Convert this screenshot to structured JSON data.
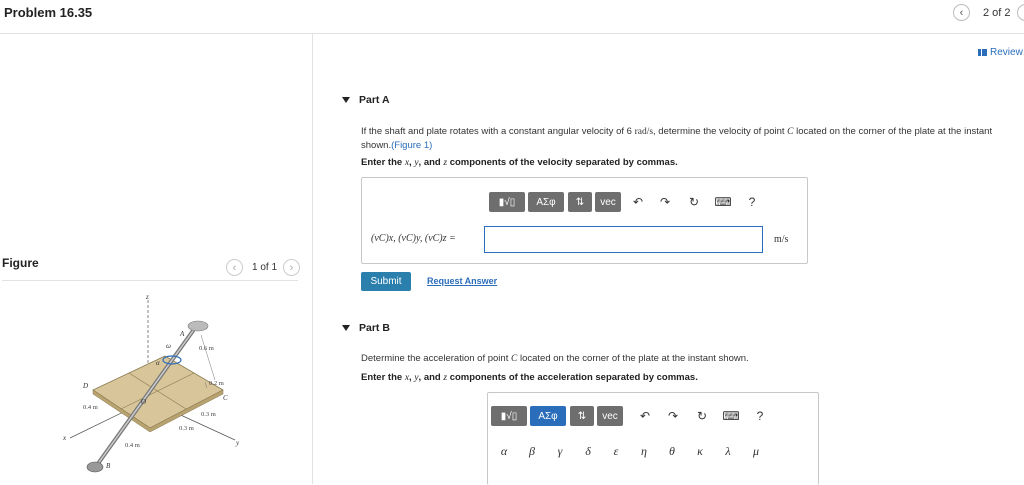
{
  "header": {
    "title": "Problem 16.35",
    "page_indicator": "2 of 2",
    "prev_icon": "chevron-left-icon",
    "next_icon": "chevron-right-icon"
  },
  "review": {
    "label": "Review"
  },
  "figure": {
    "label": "Figure",
    "pager": "1 of 1",
    "labels": {
      "z": "z",
      "x": "x",
      "y": "y",
      "omega": "ω",
      "alpha": "α",
      "A": "A",
      "B": "B",
      "C": "C",
      "D": "D",
      "O": "O",
      "d06": "0.6 m",
      "d02": "0.2 m",
      "d04a": "0.4 m",
      "d03a": "0.3 m",
      "d03b": "0.3 m",
      "d04b": "0.4 m"
    }
  },
  "partA": {
    "header": "Part A",
    "q1": "If the shaft and plate rotates with a constant angular velocity of 6",
    "q_units": "rad/s",
    "q2": ", determine the velocity of point",
    "q_point": "C",
    "q3": "located on the corner of the plate at the instant",
    "q4": "shown.",
    "fig_link": "(Figure 1)",
    "instr1": "Enter the",
    "instr_x": "x",
    "instr_y": "y",
    "instr_z": "z",
    "instr2": "components of the velocity separated by commas.",
    "input_label": "(vC)x, (vC)y, (vC)z =",
    "input_value": "",
    "unit": "m/s",
    "submit": "Submit",
    "request": "Request Answer"
  },
  "toolbar": {
    "templates": "▮√▯",
    "greek": "AΣφ",
    "arrows": "⇅",
    "vec": "vec",
    "undo": "↶",
    "redo": "↷",
    "reset": "↻",
    "keyboard": "⌨",
    "help": "?"
  },
  "partB": {
    "header": "Part B",
    "q1": "Determine the acceleration of point",
    "q_point": "C",
    "q2": "located on the corner of the plate at the instant shown.",
    "instr1": "Enter the",
    "instr_x": "x",
    "instr_y": "y",
    "instr_z": "z",
    "instr2": "components of the acceleration separated by commas.",
    "greek_row1": [
      "α",
      "β",
      "γ",
      "δ",
      "ε",
      "η",
      "θ",
      "κ",
      "λ",
      "μ"
    ]
  }
}
